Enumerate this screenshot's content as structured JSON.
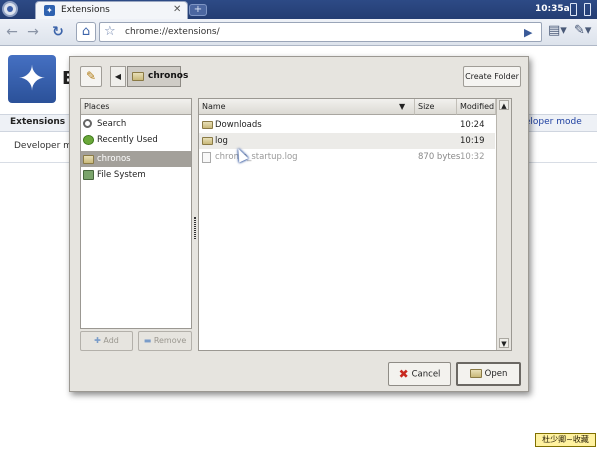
{
  "browser": {
    "tab_title": "Extensions",
    "tab_close": "✕",
    "new_tab": "+",
    "url": "chrome://extensions/",
    "clock": "10:35a"
  },
  "extensions_page": {
    "title": "E",
    "section_header": "Extensions",
    "developer_mode_link": "eveloper mode",
    "developer_mode_body": "Developer mo"
  },
  "dialog": {
    "breadcrumb": "chronos",
    "create_folder": "Create Folder",
    "places_header": "Places",
    "places": [
      {
        "label": "Search",
        "icon": "search-icon"
      },
      {
        "label": "Recently Used",
        "icon": "recent-icon"
      },
      {
        "label": "chronos",
        "icon": "folder-icon",
        "selected": true
      },
      {
        "label": "File System",
        "icon": "filesystem-icon"
      }
    ],
    "add_label": "Add",
    "remove_label": "Remove",
    "columns": {
      "name": "Name",
      "size": "Size",
      "modified": "Modified"
    },
    "files": [
      {
        "name": "Downloads",
        "size": "",
        "modified": "10:24",
        "type": "folder"
      },
      {
        "name": "log",
        "size": "",
        "modified": "10:19",
        "type": "folder"
      },
      {
        "name": "chrome_startup.log",
        "size": "870 bytes",
        "modified": "10:32",
        "type": "file"
      }
    ],
    "cancel_label": "Cancel",
    "open_label": "Open"
  },
  "watermark": "杜少卿~收藏",
  "colors": {
    "topbar": "#2d4a86",
    "dialog_bg": "#e6e4df",
    "selection": "#a3a09a"
  }
}
